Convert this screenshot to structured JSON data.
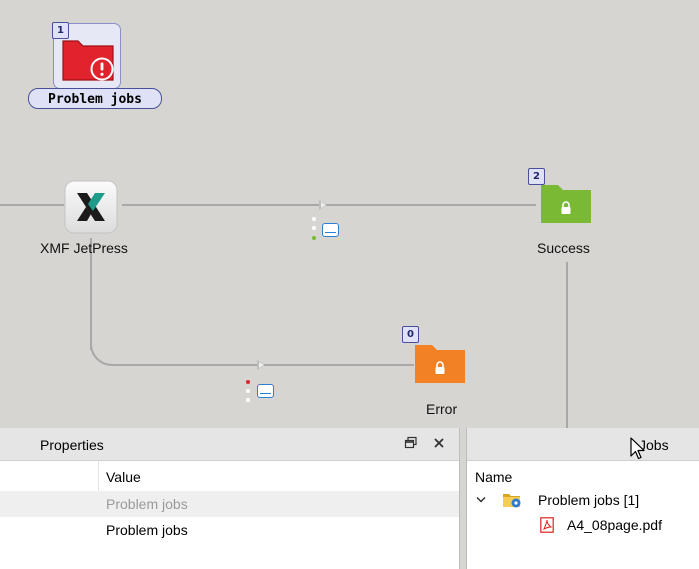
{
  "canvas": {
    "problem_folder": {
      "badge": "1",
      "label": "Problem jobs",
      "color": "#e1232e"
    },
    "xmf_element": {
      "label": "XMF JetPress"
    },
    "success_folder": {
      "badge": "2",
      "label": "Success",
      "color": "#7ab934"
    },
    "error_folder": {
      "badge": "0",
      "label": "Error",
      "color": "#f28024"
    }
  },
  "properties_panel": {
    "title": "Properties",
    "column_value": "Value",
    "rows": [
      "Problem jobs",
      "Problem jobs"
    ]
  },
  "jobs_panel": {
    "title": "Jobs",
    "column_name": "Name",
    "tree": {
      "folder_label": "Problem jobs [1]",
      "file_label": "A4_08page.pdf"
    }
  },
  "icons": [
    "warning-icon",
    "lock-icon",
    "disk-icon",
    "flow-arrow-icon",
    "restore-icon",
    "close-icon",
    "chevron-down-icon",
    "folder-gear-icon",
    "pdf-icon",
    "mouse-cursor-icon"
  ]
}
